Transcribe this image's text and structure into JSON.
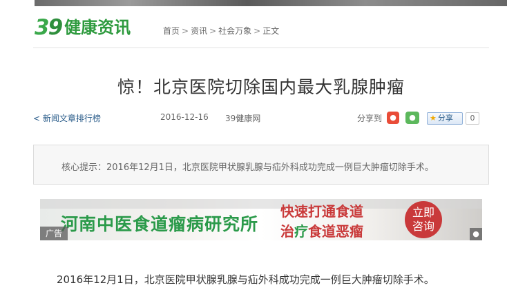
{
  "logo": {
    "num_a": "3",
    "num_b": "9",
    "text": "健康资讯"
  },
  "breadcrumb": {
    "items": [
      "首页",
      "资讯",
      "社会万象",
      "正文"
    ],
    "separator": ">"
  },
  "article": {
    "title": "惊！北京医院切除国内最大乳腺肿瘤",
    "date": "2016-12-16",
    "source": "39健康网",
    "summary": "核心提示：2016年12月1日，北京医院甲状腺乳腺与疝外科成功完成一例巨大肿瘤切除手术。",
    "first_paragraph": "2016年12月1日，北京医院甲状腺乳腺与疝外科成功完成一例巨大肿瘤切除手术。"
  },
  "meta": {
    "rank_link": "新闻文章排行榜",
    "rank_chevron": "<",
    "share_label": "分享到",
    "share_button": "分享",
    "share_count": "0"
  },
  "ad": {
    "name": "河南中医食道瘤病研究所",
    "line1": "快速打通食道",
    "line2_a": "治",
    "line2_b": "疗",
    "line2_c": "食道恶瘤",
    "consult_1": "立即",
    "consult_2": "咨询",
    "tag": "广告"
  },
  "icons": {
    "weibo": "weibo-icon",
    "wechat": "wechat-icon",
    "star": "star-icon",
    "paw": "paw-icon"
  },
  "colors": {
    "brand_green": "#2e9a3e",
    "link_blue": "#2a5c8a",
    "ad_red": "#c9393a"
  }
}
